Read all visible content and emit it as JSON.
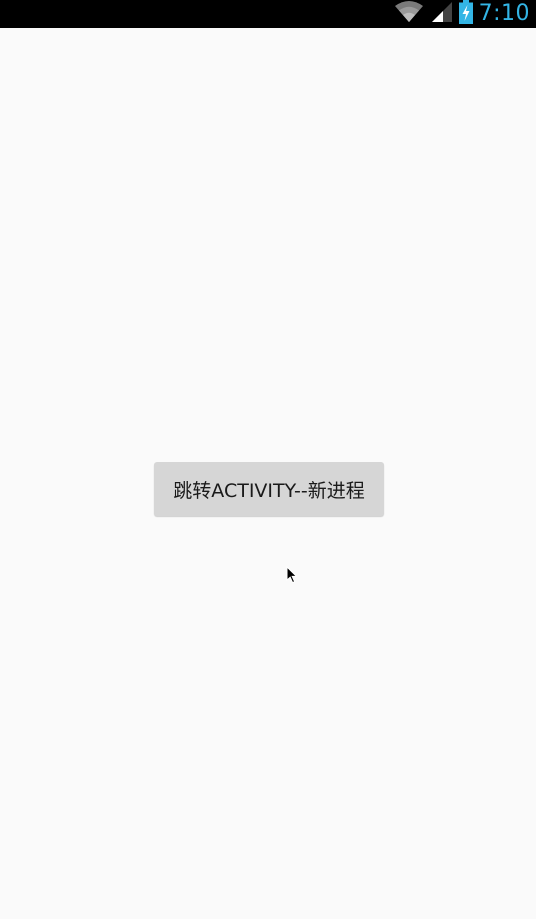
{
  "status_bar": {
    "time": "7:10",
    "icons": [
      "wifi-icon",
      "cell-signal-icon",
      "battery-charging-icon"
    ],
    "background": "#000000",
    "clock_color": "#33b5e5"
  },
  "main": {
    "button_label": "跳转ACTIVITY--新进程",
    "background": "#fafafa",
    "button_color": "#d6d6d6"
  }
}
